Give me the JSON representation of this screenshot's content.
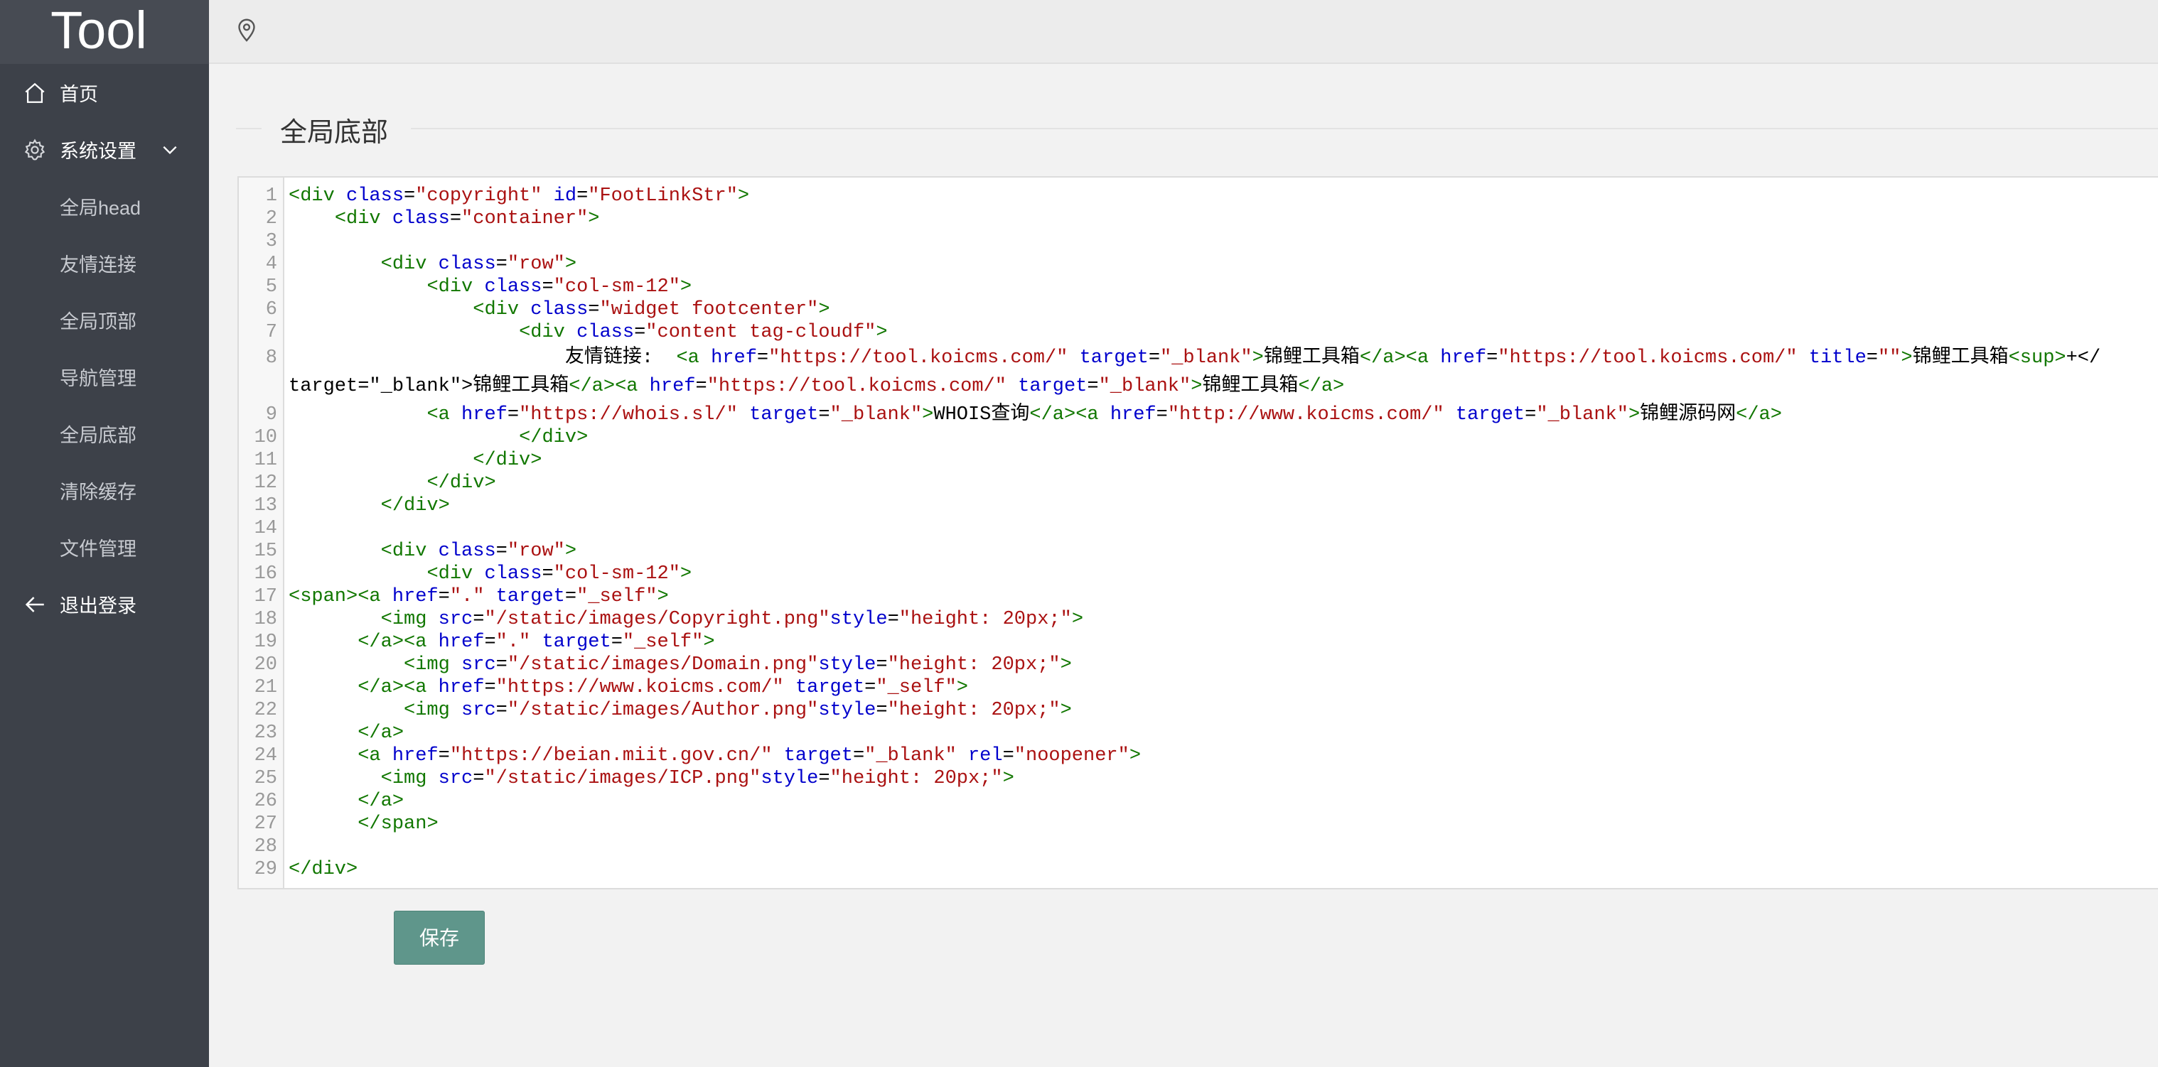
{
  "app": {
    "logo": "Tool"
  },
  "sidebar": {
    "items": [
      {
        "label": "首页",
        "icon": "home-icon"
      },
      {
        "label": "系统设置",
        "icon": "gear-icon",
        "expanded": true,
        "children": [
          {
            "label": "全局head"
          },
          {
            "label": "友情连接"
          },
          {
            "label": "全局顶部"
          },
          {
            "label": "导航管理"
          },
          {
            "label": "全局底部"
          },
          {
            "label": "清除缓存"
          },
          {
            "label": "文件管理"
          }
        ]
      },
      {
        "label": "退出登录",
        "icon": "arrow-left-icon"
      }
    ]
  },
  "topbar": {
    "icon": "location-pin-icon"
  },
  "main": {
    "section_title": "全局底部",
    "save_label": "保存",
    "editor": {
      "lines": [
        {
          "n": "1",
          "text": "<div class=\"copyright\" id=\"FootLinkStr\">"
        },
        {
          "n": "2",
          "text": "    <div class=\"container\">"
        },
        {
          "n": "3",
          "text": ""
        },
        {
          "n": "4",
          "text": "        <div class=\"row\">"
        },
        {
          "n": "5",
          "text": "            <div class=\"col-sm-12\">"
        },
        {
          "n": "6",
          "text": "                <div class=\"widget footcenter\">"
        },
        {
          "n": "7",
          "text": "                    <div class=\"content tag-cloudf\">"
        },
        {
          "n": "8",
          "text": "                        友情链接:  <a href=\"https://tool.koicms.com/\" target=\"_blank\">锦鲤工具箱</a><a href=\"https://tool.koicms.com/\" title=\"\">锦鲤工具箱<sup>+</",
          "wrap": "target=\"_blank\">锦鲤工具箱</a><a href=\"https://tool.koicms.com/\" target=\"_blank\">锦鲤工具箱</a>"
        },
        {
          "n": "9",
          "text": "            <a href=\"https://whois.sl/\" target=\"_blank\">WHOIS查询</a><a href=\"http://www.koicms.com/\" target=\"_blank\">锦鲤源码网</a>"
        },
        {
          "n": "10",
          "text": "                    </div>"
        },
        {
          "n": "11",
          "text": "                </div>"
        },
        {
          "n": "12",
          "text": "            </div>"
        },
        {
          "n": "13",
          "text": "        </div>"
        },
        {
          "n": "14",
          "text": ""
        },
        {
          "n": "15",
          "text": "        <div class=\"row\">"
        },
        {
          "n": "16",
          "text": "            <div class=\"col-sm-12\">"
        },
        {
          "n": "17",
          "text": "<span><a href=\".\" target=\"_self\">"
        },
        {
          "n": "18",
          "text": "        <img src=\"/static/images/Copyright.png\"style=\"height: 20px;\">"
        },
        {
          "n": "19",
          "text": "      </a><a href=\".\" target=\"_self\">"
        },
        {
          "n": "20",
          "text": "          <img src=\"/static/images/Domain.png\"style=\"height: 20px;\">"
        },
        {
          "n": "21",
          "text": "      </a><a href=\"https://www.koicms.com/\" target=\"_self\">"
        },
        {
          "n": "22",
          "text": "          <img src=\"/static/images/Author.png\"style=\"height: 20px;\">"
        },
        {
          "n": "23",
          "text": "      </a>"
        },
        {
          "n": "24",
          "text": "      <a href=\"https://beian.miit.gov.cn/\" target=\"_blank\" rel=\"noopener\">"
        },
        {
          "n": "25",
          "text": "        <img src=\"/static/images/ICP.png\"style=\"height: 20px;\">"
        },
        {
          "n": "26",
          "text": "      </a>"
        },
        {
          "n": "27",
          "text": "      </span>"
        },
        {
          "n": "28",
          "text": ""
        },
        {
          "n": "29",
          "text": "</div>"
        }
      ]
    }
  }
}
